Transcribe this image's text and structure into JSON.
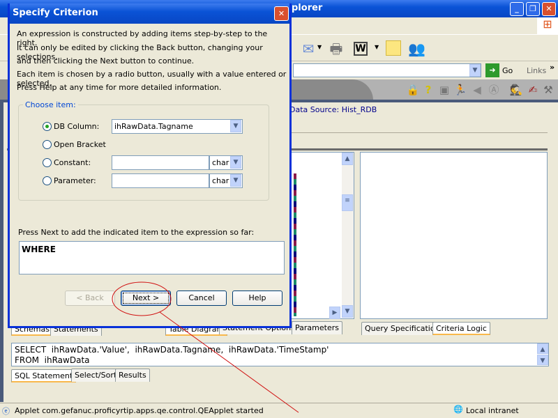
{
  "browser": {
    "title_partial": "plorer",
    "address_go": "Go",
    "links": "Links",
    "links_chevron": "»"
  },
  "applet": {
    "data_source": "Data Source: Hist_RDB",
    "left_tabs": [
      "Schemas",
      "Statements"
    ],
    "middle_tabs": [
      "Table Diagram",
      "Statement Options",
      "Parameters"
    ],
    "right_tabs": [
      "Query Specification",
      "Criteria Logic"
    ],
    "sql_lines": [
      "SELECT  ihRawData.'Value',  ihRawData.Tagname,  ihRawData.'TimeStamp'",
      "FROM  ihRawData"
    ],
    "bottom_tabs": [
      "SQL Statement",
      "Select/Sort",
      "Results"
    ]
  },
  "status": {
    "text": "Applet com.gefanuc.proficyrtip.apps.qe.control.QEApplet started",
    "zone": "Local intranet"
  },
  "dialog": {
    "title": "Specify Criterion",
    "intro": [
      "An expression is constructed by adding items step-by-step to the right.",
      "It can only be edited by clicking the Back button, changing your selections,",
      "and then clicking the Next button to continue.",
      "Each item is chosen by a radio button, usually with a value entered or selected.",
      "Press Help at any time for more detailed information."
    ],
    "group_label": "Choose item:",
    "options": {
      "db_column": "DB Column:",
      "open_bracket": "Open Bracket",
      "constant": "Constant:",
      "parameter": "Parameter:"
    },
    "selected_option": "DB Column:",
    "db_column_value": "ihRawData.Tagname",
    "constant_value": "",
    "constant_type": "char",
    "parameter_value": "",
    "parameter_type": "char",
    "expression_label": "Press Next to add the indicated item to the expression so far:",
    "expression": "WHERE",
    "buttons": {
      "back": "< Back",
      "next": "Next >",
      "cancel": "Cancel",
      "help": "Help"
    }
  },
  "annotation_color": "#D01010"
}
